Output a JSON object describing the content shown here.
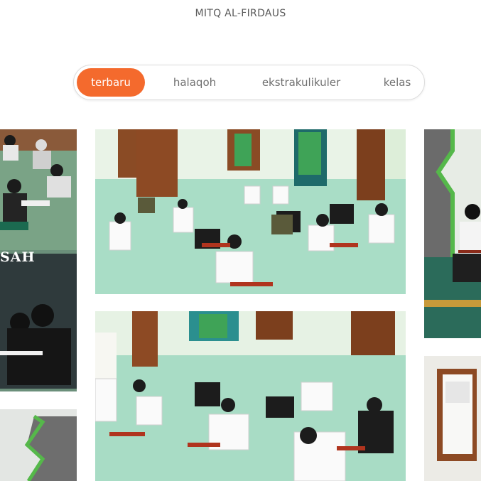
{
  "site": {
    "title": "MITQ AL-FIRDAUS"
  },
  "tabs": [
    {
      "label": "terbaru",
      "active": true
    },
    {
      "label": "halaqoh",
      "active": false
    },
    {
      "label": "ekstrakulikuler",
      "active": false
    },
    {
      "label": "kelas",
      "active": false
    }
  ],
  "gallery": {
    "left_overlay_text": "SAH",
    "accent_color": "#f46a2d"
  }
}
